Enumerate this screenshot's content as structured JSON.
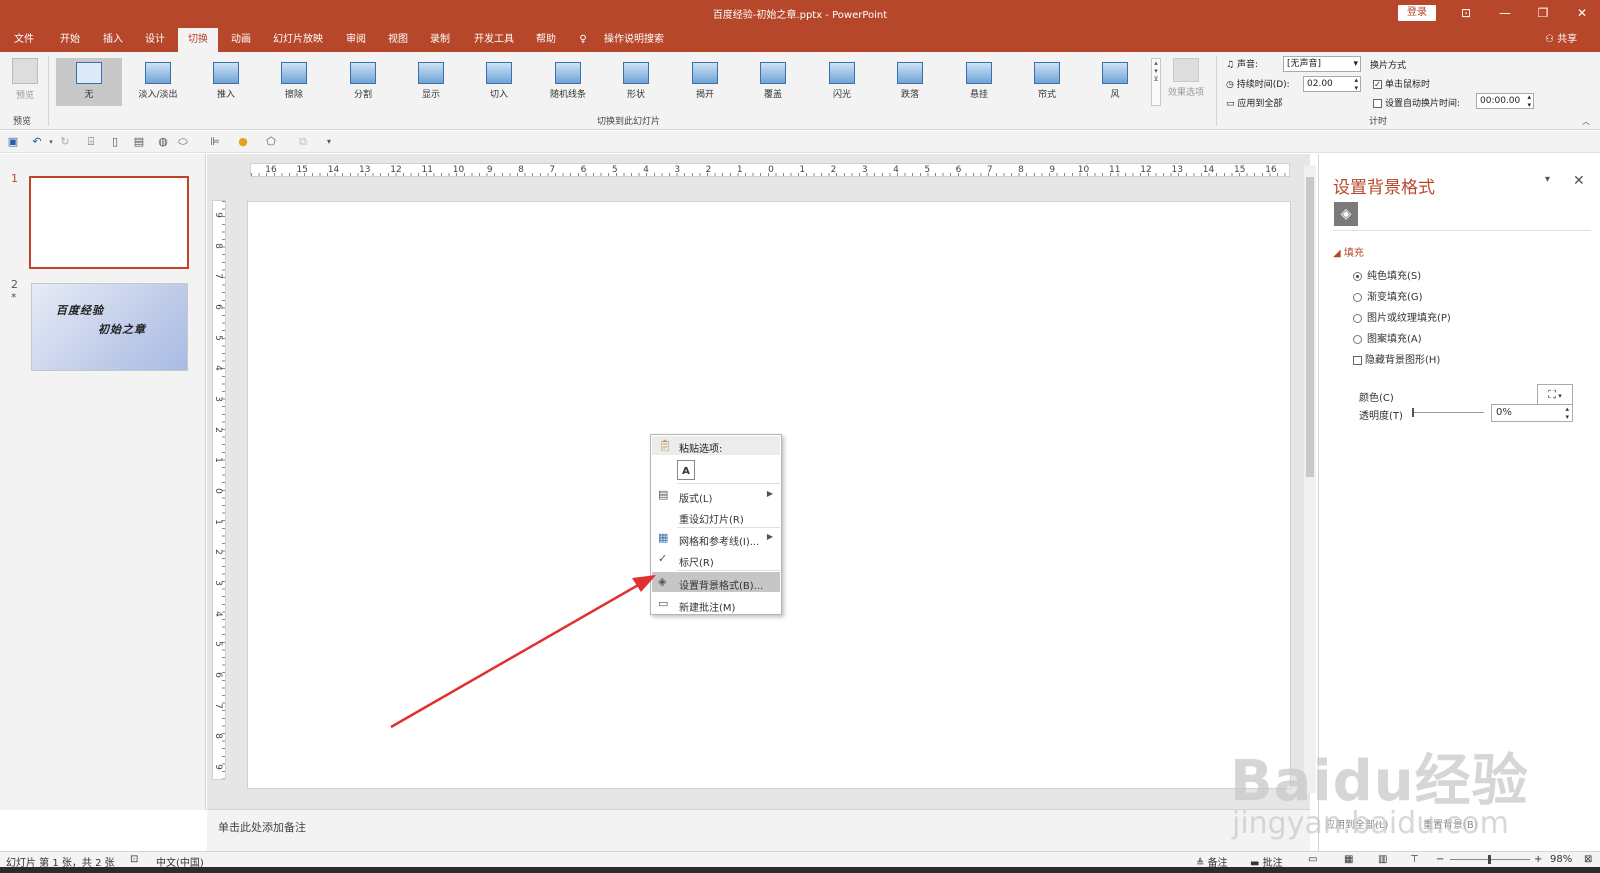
{
  "window": {
    "title": "百度经验-初始之章.pptx  -  PowerPoint",
    "login": "登录",
    "controls": [
      "⊡",
      "—",
      "❐",
      "✕"
    ]
  },
  "menu": {
    "tabs": [
      "文件",
      "开始",
      "插入",
      "设计",
      "切换",
      "动画",
      "幻灯片放映",
      "审阅",
      "视图",
      "录制",
      "开发工具",
      "帮助"
    ],
    "active_tab": "切换",
    "tell_me": "操作说明搜索",
    "share": "共享"
  },
  "ribbon": {
    "preview_label": "预览",
    "preview_group": "预览",
    "transitions": [
      "无",
      "淡入/淡出",
      "推入",
      "擦除",
      "分割",
      "显示",
      "切入",
      "随机线条",
      "形状",
      "揭开",
      "覆盖",
      "闪光",
      "跌落",
      "悬挂",
      "帘式",
      "风"
    ],
    "selected_transition": "无",
    "gallery_group": "切换到此幻灯片",
    "effect_options": "效果选项",
    "timing": {
      "sound_label": "声音:",
      "sound_value": "[无声音]",
      "duration_label": "持续时间(D):",
      "duration_value": "02.00",
      "apply_all": "应用到全部",
      "advance_label": "换片方式",
      "on_click": "单击鼠标时",
      "auto_after": "设置自动换片时间:",
      "auto_value": "00:00.00",
      "group_label": "计时"
    }
  },
  "thumbnails": {
    "slides": [
      {
        "num": "1",
        "marker": "",
        "text1": "",
        "text2": ""
      },
      {
        "num": "2",
        "marker": "*",
        "text1": "百度经验",
        "text2": "初始之章"
      }
    ]
  },
  "rulers": {
    "horizontal": [
      "16",
      "15",
      "14",
      "13",
      "12",
      "11",
      "10",
      "9",
      "8",
      "7",
      "6",
      "5",
      "4",
      "3",
      "2",
      "1",
      "0",
      "1",
      "2",
      "3",
      "4",
      "5",
      "6",
      "7",
      "8",
      "9",
      "10",
      "11",
      "12",
      "13",
      "14",
      "15",
      "16"
    ],
    "vertical": [
      "9",
      "8",
      "7",
      "6",
      "5",
      "4",
      "3",
      "2",
      "1",
      "0",
      "1",
      "2",
      "3",
      "4",
      "5",
      "6",
      "7",
      "8",
      "9"
    ]
  },
  "notes_placeholder": "单击此处添加备注",
  "context_menu": {
    "paste_header": "粘贴选项:",
    "items": [
      {
        "label": "版式(L)",
        "icon": "layout-icon",
        "submenu": true
      },
      {
        "label": "重设幻灯片(R)",
        "icon": "",
        "submenu": false
      },
      {
        "label": "网格和参考线(I)...",
        "icon": "grid-icon",
        "submenu": true
      },
      {
        "label": "标尺(R)",
        "icon": "checkmark-icon",
        "submenu": false
      },
      {
        "label": "设置背景格式(B)...",
        "icon": "format-background-icon",
        "submenu": false,
        "highlighted": true
      },
      {
        "label": "新建批注(M)",
        "icon": "comment-icon",
        "submenu": false
      }
    ]
  },
  "format_pane": {
    "title": "设置背景格式",
    "section": "填充",
    "options": [
      "纯色填充(S)",
      "渐变填充(G)",
      "图片或纹理填充(P)",
      "图案填充(A)"
    ],
    "selected_option": "纯色填充(S)",
    "hide_bg": "隐藏背景图形(H)",
    "color_label": "颜色(C)",
    "transparency_label": "透明度(T)",
    "transparency_value": "0%",
    "transparency_fraction": 0,
    "apply_all": "应用到全部(L)",
    "reset": "重置背景(B)"
  },
  "status": {
    "slide_info": "幻灯片 第 1 张，共 2 张",
    "language": "中文(中国)",
    "notes": "备注",
    "comments": "批注",
    "zoom": "98%"
  },
  "watermark": {
    "text1": "Baidu经验",
    "text2": "jingyan.baidu.com"
  },
  "colors": {
    "accent": "#b7472a",
    "annotation_arrow": "#e03030"
  }
}
